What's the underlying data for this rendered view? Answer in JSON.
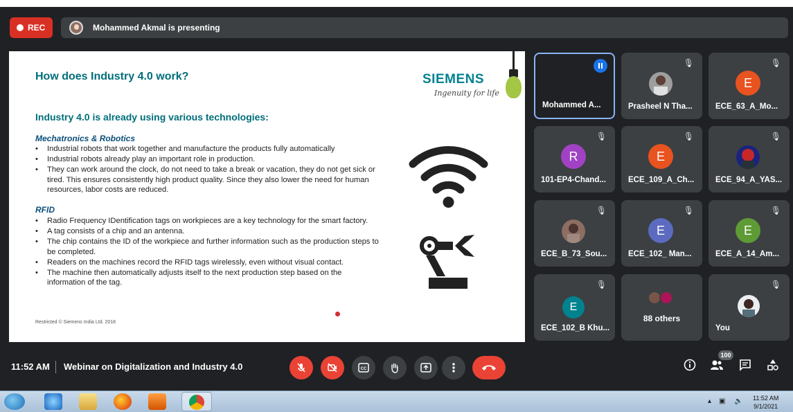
{
  "topbar": {
    "rec_label": "REC",
    "presenting_text": "Mohammed Akmal is presenting"
  },
  "slide": {
    "title": "How does Industry 4.0 work?",
    "brand": "SIEMENS",
    "tagline": "Ingenuity for life",
    "subheading": "Industry 4.0 is already using various technologies:",
    "section1_title": "Mechatronics & Robotics",
    "section1_bullets": [
      "Industrial robots that work together and manufacture the products fully automatically",
      "Industrial robots already play an important role in production.",
      "They can work around the clock, do not need to take a break or vacation, they do not get sick or tired. This ensures consistently high product quality. Since they also lower the need for human resources, labor costs are reduced."
    ],
    "section2_title": "RFID",
    "section2_bullets": [
      "Radio Frequency IDentification tags on workpieces are a key technology for the smart factory.",
      "A tag consists of a chip and an antenna.",
      "The chip contains the ID of the workpiece and further information such as the production steps to be completed.",
      "Readers on the machines record the RFID tags wirelessly, even without visual contact.",
      "The machine then automatically adjusts itself to the next production step based on the information of the tag."
    ],
    "footer": "Restricted © Siemens India Ltd. 2018"
  },
  "participants": [
    {
      "name": "Mohammed A...",
      "avatar": "",
      "color": "",
      "state": "speaking"
    },
    {
      "name": "Prasheel N Tha...",
      "avatar": "",
      "color": "",
      "state": "muted"
    },
    {
      "name": "ECE_63_A_Mo...",
      "avatar": "E",
      "color": "#e8531f",
      "state": "muted"
    },
    {
      "name": "101-EP4-Chand...",
      "avatar": "R",
      "color": "#a142c4",
      "state": "muted"
    },
    {
      "name": "ECE_109_A_Ch...",
      "avatar": "E",
      "color": "#e8531f",
      "state": "muted"
    },
    {
      "name": "ECE_94_A_YAS...",
      "avatar": "",
      "color": "",
      "state": "muted"
    },
    {
      "name": "ECE_B_73_Sou...",
      "avatar": "",
      "color": "",
      "state": "muted"
    },
    {
      "name": "ECE_102_ Man...",
      "avatar": "E",
      "color": "#5c6bc0",
      "state": "muted"
    },
    {
      "name": "ECE_A_14_Am...",
      "avatar": "E",
      "color": "#5e9b35",
      "state": "muted"
    },
    {
      "name": "ECE_102_B Khu...",
      "avatar": "E",
      "color": "#00838f",
      "state": "muted"
    },
    {
      "name": "88 others",
      "avatar": "",
      "color": "",
      "state": "group"
    },
    {
      "name": "You",
      "avatar": "",
      "color": "",
      "state": "muted"
    }
  ],
  "bottombar": {
    "time": "11:52 AM",
    "meeting_title": "Webinar on Digitalization and Industry 4.0",
    "controls": [
      "mic-off",
      "camera-off",
      "captions",
      "raise-hand",
      "present",
      "more-options",
      "leave-call"
    ],
    "people_count": "100"
  },
  "taskbar": {
    "time": "11:52 AM",
    "date": "9/1/2021"
  },
  "colors": {
    "meet_bg": "#202124",
    "tile_bg": "#3c4043",
    "danger": "#ea4335",
    "slide_heading": "#006e7a"
  }
}
